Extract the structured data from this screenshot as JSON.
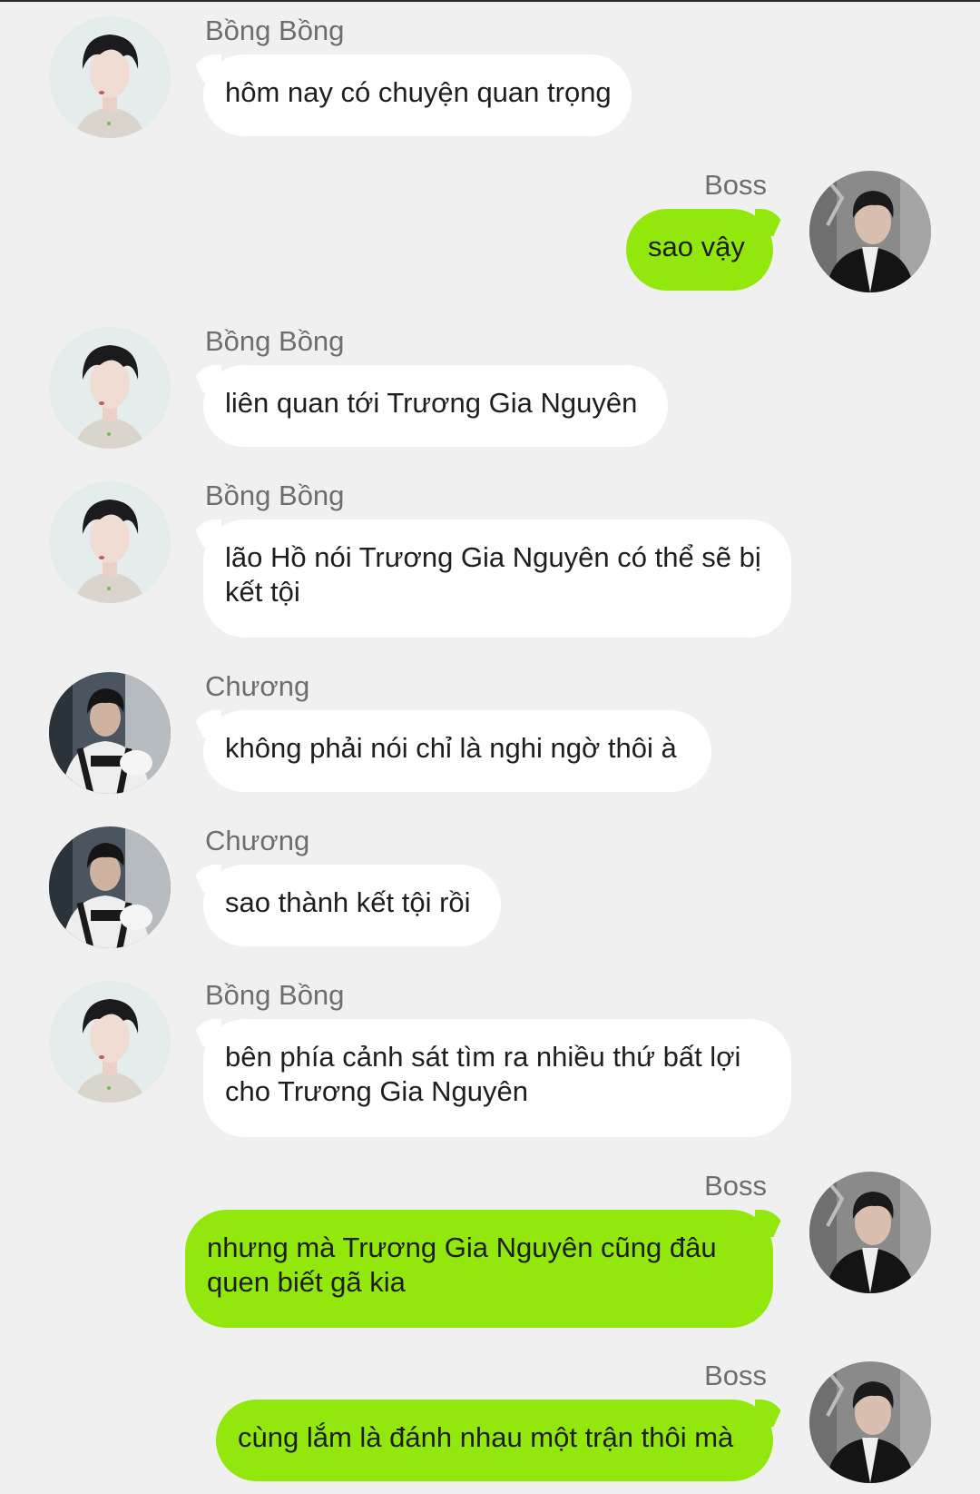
{
  "colors": {
    "background": "#f0f0f0",
    "incoming_bubble": "#ffffff",
    "outgoing_bubble": "#92e80c",
    "sender_name": "#6e6e6e",
    "message_text": "#1e1e1e"
  },
  "messages": [
    {
      "sender": "Bồng Bồng",
      "text": "hôm nay có chuyện quan trọng",
      "side": "left",
      "avatar": "bong-bong-avatar"
    },
    {
      "sender": "Boss",
      "text": "sao vậy",
      "side": "right",
      "avatar": "boss-avatar"
    },
    {
      "sender": "Bồng Bồng",
      "text": "liên quan tới Trương Gia Nguyên",
      "side": "left",
      "avatar": "bong-bong-avatar"
    },
    {
      "sender": "Bồng Bồng",
      "text": "lão Hồ nói Trương Gia Nguyên có thể sẽ bị kết tội",
      "side": "left",
      "avatar": "bong-bong-avatar"
    },
    {
      "sender": "Chương",
      "text": "không phải nói chỉ là nghi ngờ thôi à",
      "side": "left",
      "avatar": "chuong-avatar"
    },
    {
      "sender": "Chương",
      "text": "sao thành kết tội rồi",
      "side": "left",
      "avatar": "chuong-avatar"
    },
    {
      "sender": "Bồng Bồng",
      "text": "bên phía cảnh sát tìm ra nhiều thứ bất lợi cho Trương Gia Nguyên",
      "side": "left",
      "avatar": "bong-bong-avatar"
    },
    {
      "sender": "Boss",
      "text": "nhưng mà Trương Gia Nguyên cũng đâu quen biết gã kia",
      "side": "right",
      "avatar": "boss-avatar"
    },
    {
      "sender": "Boss",
      "text": "cùng lắm là đánh nhau một trận thôi mà",
      "side": "right",
      "avatar": "boss-avatar"
    }
  ]
}
